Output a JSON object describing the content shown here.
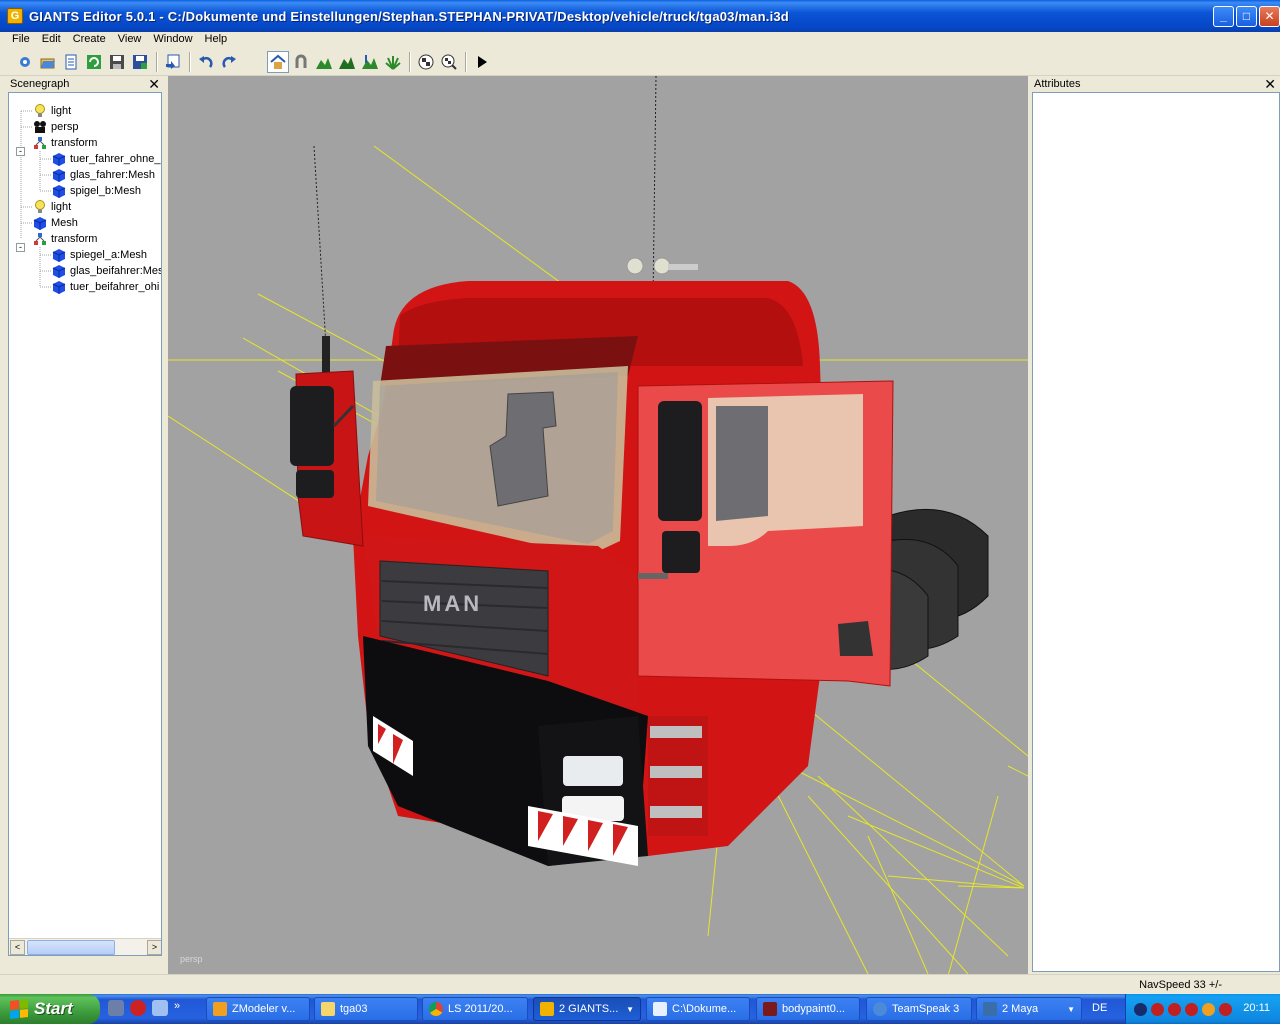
{
  "window": {
    "title": "GIANTS Editor 5.0.1 - C:/Dokumente und Einstellungen/Stephan.STEPHAN-PRIVAT/Desktop/vehicle/truck/tga03/man.i3d",
    "icon_letter": "G",
    "minimize": "_",
    "maximize": "□",
    "close": "✕"
  },
  "menu": [
    "File",
    "Edit",
    "Create",
    "View",
    "Window",
    "Help"
  ],
  "toolbar": {
    "icons": [
      "new-icon",
      "open-icon",
      "properties-icon",
      "refresh-icon",
      "save-icon",
      "save-as-icon",
      "import-icon",
      "undo-icon",
      "redo-icon",
      "home-icon",
      "magnet-icon",
      "terrain-icon",
      "terrain-paint-icon",
      "terrain-sculpt-icon",
      "foliage-icon",
      "checker-icon",
      "checker-zoom-icon",
      "play-icon"
    ]
  },
  "scenegraph": {
    "title": "Scenegraph",
    "close": "✕",
    "nodes": [
      {
        "label": "light",
        "icon": "light-icon",
        "depth": 0
      },
      {
        "label": "persp",
        "icon": "camera-icon",
        "depth": 0
      },
      {
        "label": "transform",
        "icon": "transform-icon",
        "depth": 0,
        "expanded": "-"
      },
      {
        "label": "tuer_fahrer_ohne_",
        "icon": "mesh-icon",
        "depth": 1
      },
      {
        "label": "glas_fahrer:Mesh",
        "icon": "mesh-icon",
        "depth": 1
      },
      {
        "label": "spigel_b:Mesh",
        "icon": "mesh-icon",
        "depth": 1
      },
      {
        "label": "light",
        "icon": "light-icon",
        "depth": 0
      },
      {
        "label": "Mesh",
        "icon": "mesh-icon",
        "depth": 0
      },
      {
        "label": "transform",
        "icon": "transform-icon",
        "depth": 0,
        "expanded": "-"
      },
      {
        "label": "spiegel_a:Mesh",
        "icon": "mesh-icon",
        "depth": 1
      },
      {
        "label": "glas_beifahrer:Mes",
        "icon": "mesh-icon",
        "depth": 1
      },
      {
        "label": "tuer_beifahrer_ohi",
        "icon": "mesh-icon",
        "depth": 1
      }
    ],
    "scroll_left": "<",
    "scroll_right": ">"
  },
  "viewport": {
    "camera_label": "persp",
    "grille_text": "MAN",
    "colors": {
      "background": "#a2a2a2",
      "cab": "#e21a1a",
      "grid": "#e6e62a"
    }
  },
  "attributes": {
    "title": "Attributes",
    "close": "✕"
  },
  "status": {
    "navspeed": "NavSpeed 33 +/-"
  },
  "taskbar": {
    "start": "Start",
    "quicklaunch": [
      "show-desktop-icon",
      "media-icon",
      "browser-icon"
    ],
    "expander": "»",
    "buttons": [
      {
        "label": "ZModeler v...",
        "icon": "zmodeler-icon",
        "active": false
      },
      {
        "label": "tga03",
        "icon": "folder-icon",
        "active": false
      },
      {
        "label": "LS 2011/20...",
        "icon": "chrome-icon",
        "active": false
      },
      {
        "label": "2 GIANTS...",
        "icon": "giants-icon",
        "active": true
      },
      {
        "label": "C:\\Dokume...",
        "icon": "notepad-icon",
        "active": false
      },
      {
        "label": "bodypaint0...",
        "icon": "bodypaint-icon",
        "active": false
      },
      {
        "label": "TeamSpeak 3",
        "icon": "teamspeak-icon",
        "active": false
      },
      {
        "label": "2 Maya",
        "icon": "maya-icon",
        "active": false
      }
    ],
    "language": "DE",
    "clock": "20:11"
  }
}
